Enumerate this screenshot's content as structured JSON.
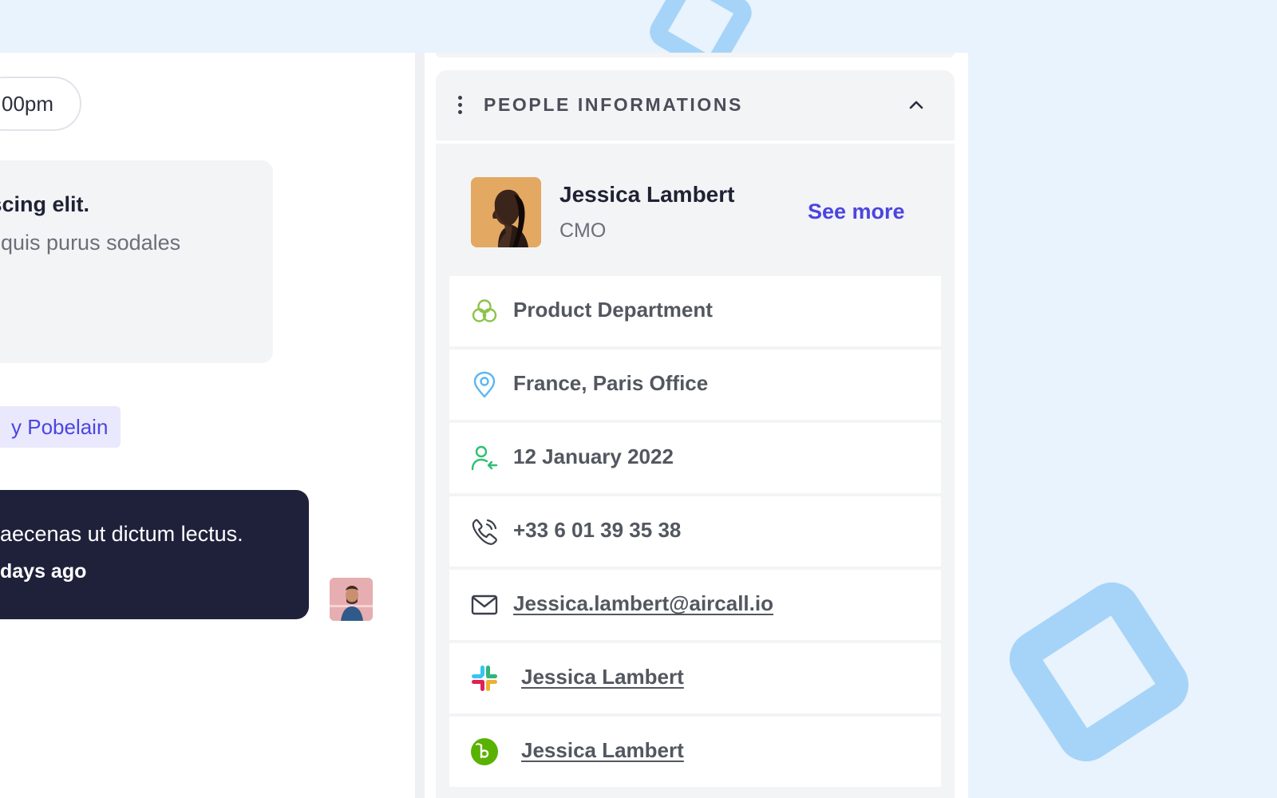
{
  "chat": {
    "time_pill": "00pm",
    "note_title": "iscing elit.",
    "note_text": "it quis purus sodales",
    "mention": "y Pobelain",
    "message_text": "aecenas ut dictum lectus.",
    "message_time": "days ago"
  },
  "panel": {
    "title": "PEOPLE INFORMATIONS",
    "profile": {
      "name": "Jessica Lambert",
      "role": "CMO",
      "see_more": "See more"
    },
    "rows": [
      {
        "icon": "team-icon",
        "text": "Product Department",
        "color": "#8bc34a"
      },
      {
        "icon": "location-pin-icon",
        "text": "France, Paris Office",
        "color": "#5bb6f2"
      },
      {
        "icon": "user-join-icon",
        "text": "12 January 2022",
        "color": "#2fbf71"
      },
      {
        "icon": "phone-icon",
        "text": "+33 6 01 39 35 38",
        "color": "#3b3f4a"
      },
      {
        "icon": "mail-icon",
        "text": "Jessica.lambert@aircall.io",
        "color": "#3b3f4a"
      },
      {
        "icon": "slack-icon",
        "text": "Jessica Lambert"
      },
      {
        "icon": "bamboohr-icon",
        "text": "Jessica Lambert",
        "color": "#59b200"
      }
    ]
  },
  "colors": {
    "accent": "#4b45e0",
    "background": "#e9f3fd",
    "decoration": "#a6d4f8",
    "bubble_dark": "#1f213b"
  }
}
